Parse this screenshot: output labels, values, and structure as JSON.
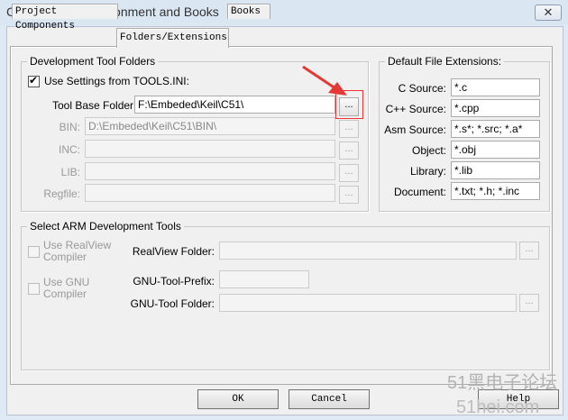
{
  "window": {
    "title": "Components, Environment and Books",
    "close_glyph": "✕"
  },
  "tabs": [
    {
      "label": "Project Components"
    },
    {
      "label": "Folders/Extensions"
    },
    {
      "label": "Books"
    }
  ],
  "dev_tool_folders": {
    "title": "Development Tool Folders",
    "use_settings_label": "Use Settings from TOOLS.INI:",
    "use_settings_checked": true,
    "tool_base_label": "Tool Base Folder:",
    "tool_base_value": "F:\\Embeded\\Keil\\C51\\",
    "bin_label": "BIN:",
    "bin_value": "D:\\Embeded\\Keil\\C51\\BIN\\",
    "inc_label": "INC:",
    "inc_value": "",
    "lib_label": "LIB:",
    "lib_value": "",
    "regfile_label": "Regfile:",
    "regfile_value": "",
    "browse_label": "..."
  },
  "file_extensions": {
    "title": "Default File Extensions:",
    "rows": [
      {
        "label": "C Source:",
        "value": "*.c"
      },
      {
        "label": "C++ Source:",
        "value": "*.cpp"
      },
      {
        "label": "Asm Source:",
        "value": "*.s*; *.src; *.a*"
      },
      {
        "label": "Object:",
        "value": "*.obj"
      },
      {
        "label": "Library:",
        "value": "*.lib"
      },
      {
        "label": "Document:",
        "value": "*.txt; *.h; *.inc"
      }
    ]
  },
  "arm_tools": {
    "title": "Select ARM Development Tools",
    "use_realview_line1": "Use RealView",
    "use_realview_line2": "Compiler",
    "use_gnu_line1": "Use GNU",
    "use_gnu_line2": "Compiler",
    "realview_folder_label": "RealView Folder:",
    "realview_folder_value": "",
    "gnu_prefix_label": "GNU-Tool-Prefix:",
    "gnu_prefix_value": "",
    "gnu_folder_label": "GNU-Tool Folder:",
    "gnu_folder_value": "",
    "browse_label": "..."
  },
  "buttons": {
    "ok": "OK",
    "cancel": "Cancel",
    "help": "Help"
  },
  "watermark": {
    "line1": "51黑电子论坛",
    "line2": "51hei.com"
  },
  "annotation": {
    "arrow_color": "#e53935"
  }
}
